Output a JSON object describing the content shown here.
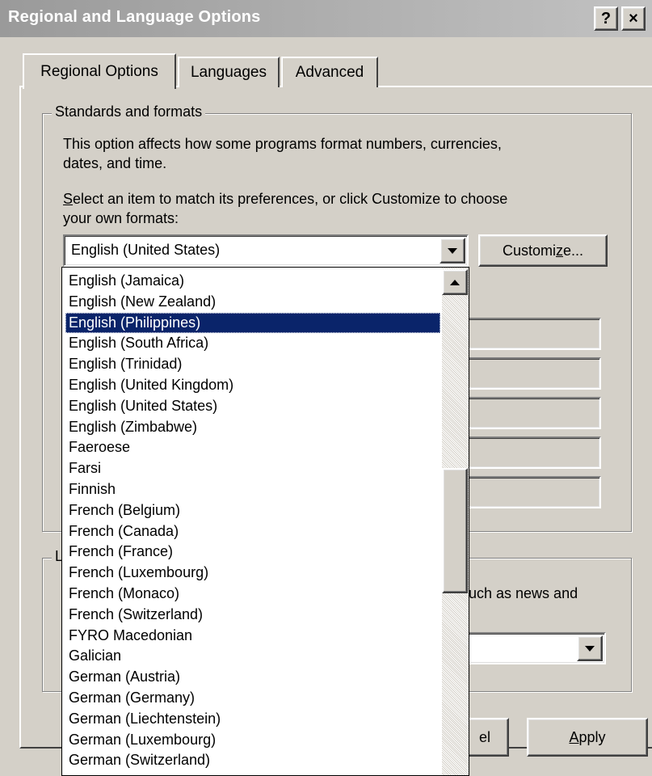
{
  "window": {
    "title": "Regional and Language Options",
    "help_button": "?",
    "close_button": "×"
  },
  "tabs": [
    {
      "label": "Regional Options",
      "active": true
    },
    {
      "label": "Languages",
      "active": false
    },
    {
      "label": "Advanced",
      "active": false
    }
  ],
  "standards": {
    "legend": "Standards and formats",
    "description_line1": "This option affects how some programs format numbers, currencies,",
    "description_line2": "dates, and time.",
    "select_line1_mnemonic": "S",
    "select_line1_rest": "elect an item to match its preferences, or click Customize to choose",
    "select_line2": "your own formats:",
    "selected_locale": "English (United States)",
    "customize_pre": "Customi",
    "customize_mnemonic": "z",
    "customize_post": "e..."
  },
  "location": {
    "legend_partial": "L",
    "description_partial": "uch as news and"
  },
  "dropdown": {
    "items": [
      "English (Jamaica)",
      "English (New Zealand)",
      "English (Philippines)",
      "English (South Africa)",
      "English (Trinidad)",
      "English (United Kingdom)",
      "English (United States)",
      "English (Zimbabwe)",
      "Faeroese",
      "Farsi",
      "Finnish",
      "French (Belgium)",
      "French (Canada)",
      "French (France)",
      "French (Luxembourg)",
      "French (Monaco)",
      "French (Switzerland)",
      "FYRO Macedonian",
      "Galician",
      "German (Austria)",
      "German (Germany)",
      "German (Liechtenstein)",
      "German (Luxembourg)",
      "German (Switzerland)"
    ],
    "selected_index": 2
  },
  "buttons": {
    "cancel_partial": "el",
    "apply_mnemonic": "A",
    "apply_rest": "pply"
  },
  "colors": {
    "face": "#d4d0c8",
    "selection": "#0a246a",
    "title_gradient_start": "#9a9a9a",
    "title_gradient_end": "#c2c2c2"
  }
}
